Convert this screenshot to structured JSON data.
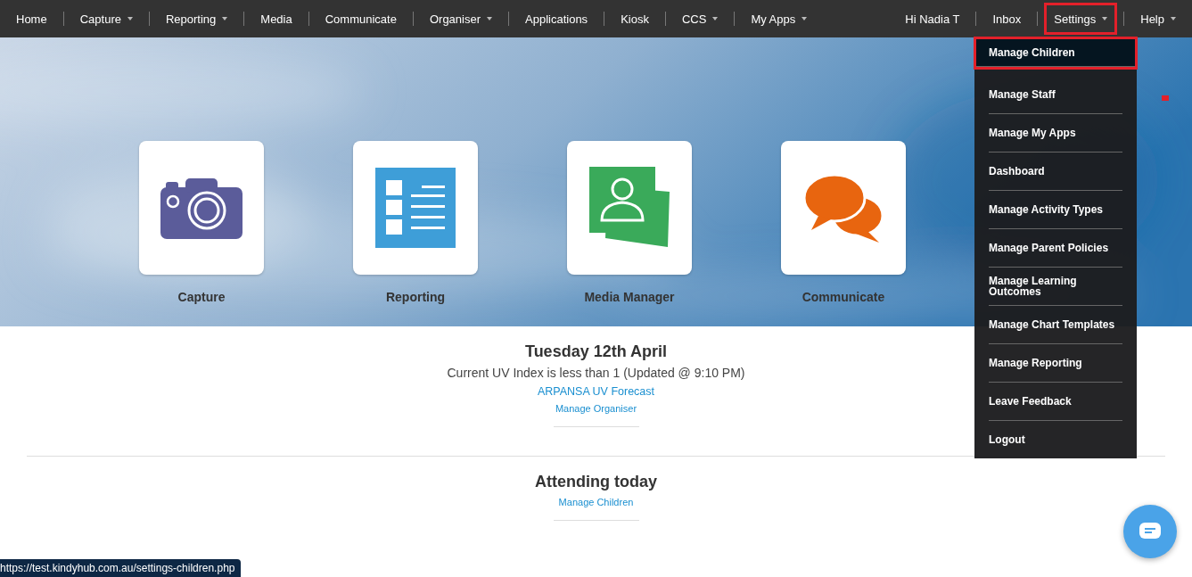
{
  "nav": {
    "left": [
      {
        "label": "Home",
        "caret": false,
        "highlighted": false
      },
      {
        "label": "Capture",
        "caret": true,
        "highlighted": false
      },
      {
        "label": "Reporting",
        "caret": true,
        "highlighted": false
      },
      {
        "label": "Media",
        "caret": false,
        "highlighted": false
      },
      {
        "label": "Communicate",
        "caret": false,
        "highlighted": false
      },
      {
        "label": "Organiser",
        "caret": true,
        "highlighted": false
      },
      {
        "label": "Applications",
        "caret": false,
        "highlighted": false
      },
      {
        "label": "Kiosk",
        "caret": false,
        "highlighted": false
      },
      {
        "label": "CCS",
        "caret": true,
        "highlighted": false
      },
      {
        "label": "My Apps",
        "caret": true,
        "highlighted": false
      }
    ],
    "right": [
      {
        "label": "Hi Nadia T",
        "caret": false,
        "highlighted": false
      },
      {
        "label": "Inbox",
        "caret": false,
        "highlighted": false
      },
      {
        "label": "Settings",
        "caret": true,
        "highlighted": true
      },
      {
        "label": "Help",
        "caret": true,
        "highlighted": false
      }
    ]
  },
  "settings_menu": [
    {
      "label": "Manage Children",
      "highlighted": true
    },
    {
      "label": "Manage Staff",
      "highlighted": false
    },
    {
      "label": "Manage My Apps",
      "highlighted": false
    },
    {
      "label": "Dashboard",
      "highlighted": false
    },
    {
      "label": "Manage Activity Types",
      "highlighted": false
    },
    {
      "label": "Manage Parent Policies",
      "highlighted": false
    },
    {
      "label": "Manage Learning Outcomes",
      "highlighted": false
    },
    {
      "label": "Manage Chart Templates",
      "highlighted": false
    },
    {
      "label": "Manage Reporting",
      "highlighted": false
    },
    {
      "label": "Leave Feedback",
      "highlighted": false
    },
    {
      "label": "Logout",
      "highlighted": false
    }
  ],
  "apps": [
    {
      "kind": "camera",
      "label": "Capture"
    },
    {
      "kind": "report",
      "label": "Reporting"
    },
    {
      "kind": "media",
      "label": "Media Manager"
    },
    {
      "kind": "chat",
      "label": "Communicate"
    }
  ],
  "organiser": {
    "date": "Tuesday 12th April",
    "uv_text": "Current UV Index is less than 1 (Updated @ 9:10 PM)",
    "forecast_link": "ARPANSA UV Forecast",
    "manage_link": "Manage Organiser"
  },
  "attending": {
    "title": "Attending today",
    "manage_link": "Manage Children"
  },
  "status_url": "https://test.kindyhub.com.au/settings-children.php"
}
